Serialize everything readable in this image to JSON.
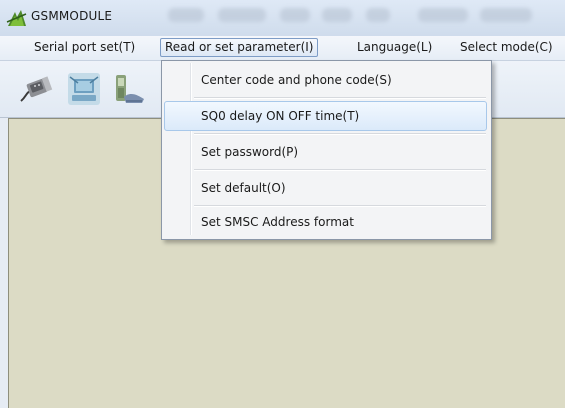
{
  "window": {
    "title": "GSMMODULE"
  },
  "menubar": {
    "items": [
      {
        "label": "Serial port set(T)"
      },
      {
        "label": "Read or set parameter(I)"
      },
      {
        "label": "Language(L)"
      },
      {
        "label": "Select mode(C)"
      }
    ],
    "active_index": 1
  },
  "toolbar": {
    "buttons": [
      {
        "icon": "serial-connector-icon"
      },
      {
        "icon": "network-computer-icon"
      },
      {
        "icon": "phone-device-icon"
      }
    ]
  },
  "dropdown": {
    "items": [
      {
        "label": "Center code and phone code(S)"
      },
      {
        "label": "SQ0 delay ON OFF time(T)"
      },
      {
        "label": "Set password(P)"
      },
      {
        "label": "Set default(O)"
      },
      {
        "label": "Set SMSC Address format"
      }
    ],
    "hovered_index": 1
  },
  "colors": {
    "client_background": "#dcdbc5",
    "menu_highlight": "#dbeafa",
    "menu_highlight_border": "#a8c8ea"
  }
}
